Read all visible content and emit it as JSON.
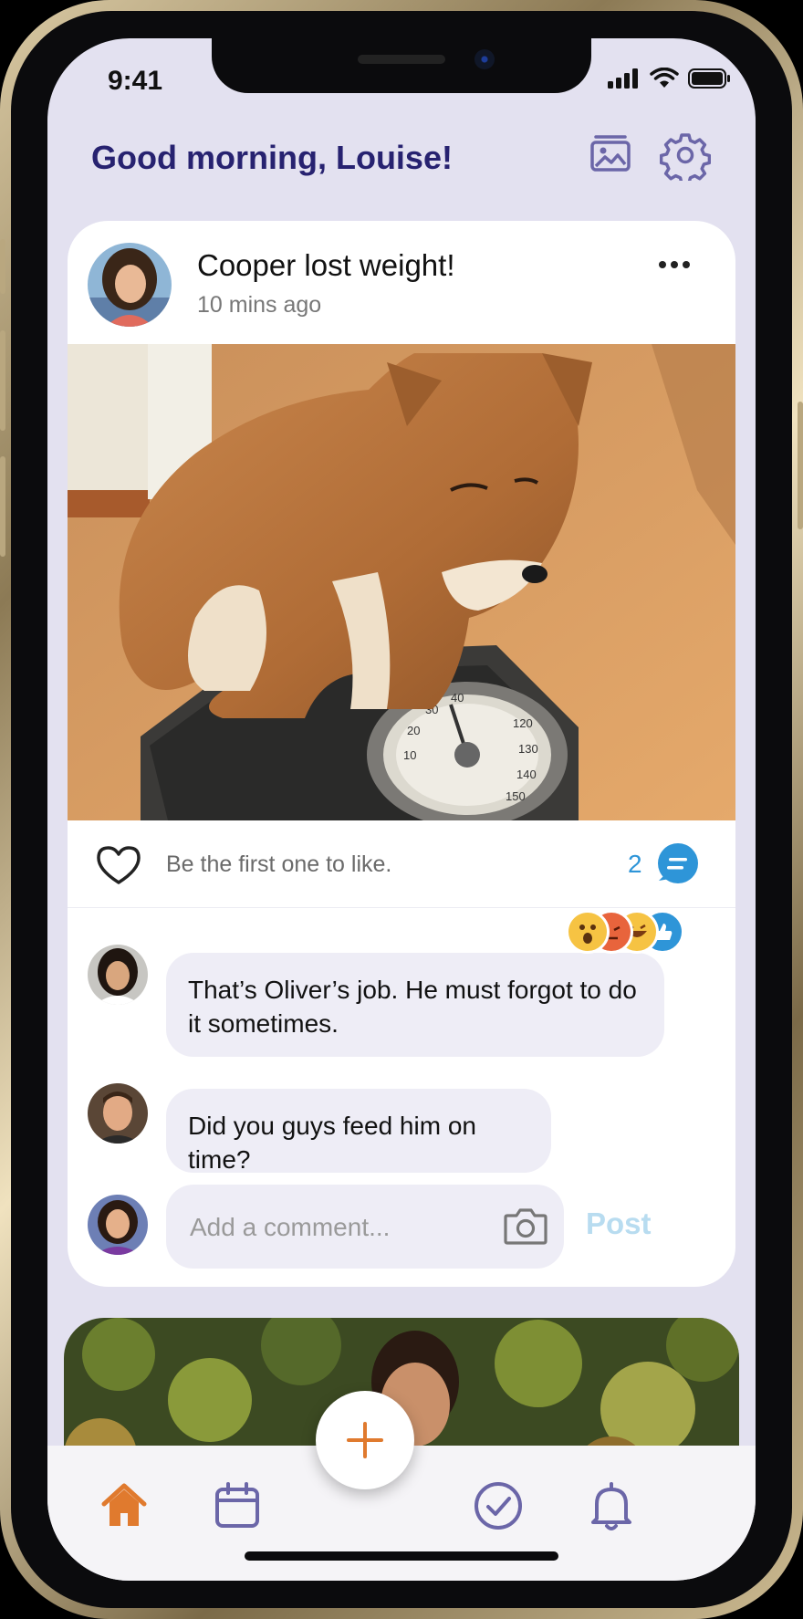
{
  "status_bar": {
    "time": "9:41"
  },
  "header": {
    "greeting": "Good morning, Louise!"
  },
  "post": {
    "title": "Cooper lost weight!",
    "time_ago": "10 mins ago",
    "like_prompt": "Be the first one to like.",
    "comment_count": "2",
    "photo_description": "dog-on-scale-photo",
    "scale_numbers": [
      "10",
      "20",
      "30",
      "40",
      "120",
      "130",
      "140",
      "150"
    ]
  },
  "comments": [
    {
      "text": "That’s Oliver’s job. He must forgot to do it sometimes."
    },
    {
      "text": "Did you guys feed him on time?"
    }
  ],
  "reactions": [
    "wow-icon",
    "angry-icon",
    "laugh-icon",
    "thumbs-up-icon"
  ],
  "composer": {
    "placeholder": "Add a comment...",
    "post_label": "Post"
  },
  "tabbar": {
    "items": [
      "home-icon",
      "calendar-icon",
      "add-icon",
      "check-icon",
      "bell-icon"
    ]
  },
  "colors": {
    "accent": "#E07A2E",
    "title": "#272270",
    "icon": "#6B66A8",
    "link": "#2E95D8",
    "background": "#E3E1F0"
  }
}
